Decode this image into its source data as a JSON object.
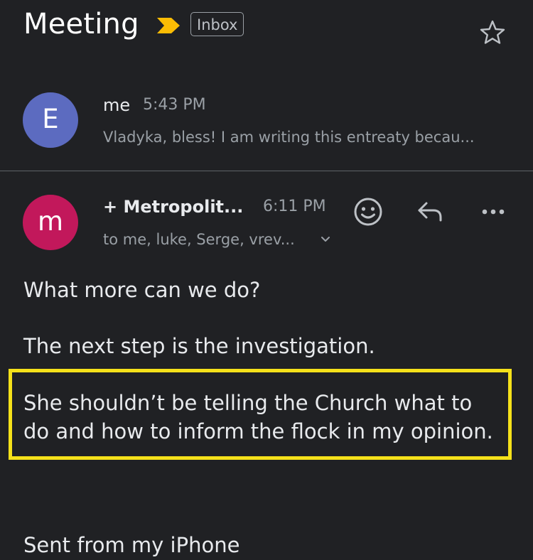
{
  "header": {
    "subject": "Meeting",
    "label": "Inbox",
    "importance_color": "#fbbc04",
    "star_icon": "star-outline-icon"
  },
  "messages": [
    {
      "avatar_letter": "E",
      "avatar_color": "#5c6bc0",
      "sender": "me",
      "time": "5:43 PM",
      "snippet": "Vladyka, bless! I am writing this entreaty becau..."
    },
    {
      "avatar_letter": "m",
      "avatar_color": "#c2185b",
      "sender": "+ Metropolit...",
      "time": "6:11 PM",
      "recipients": "to me, luke, Serge, vrev...",
      "actions": [
        "emoji-reaction-icon",
        "reply-icon",
        "more-options-icon"
      ],
      "body": {
        "line1": "What more can we do?",
        "line2": "The next step is the investigation.",
        "line3": "She shouldn’t be telling the Church what to",
        "line4": "do and how to inform the flock in my opinion.",
        "signature": "Sent from my iPhone"
      }
    }
  ],
  "highlight_color": "#f5e11a"
}
